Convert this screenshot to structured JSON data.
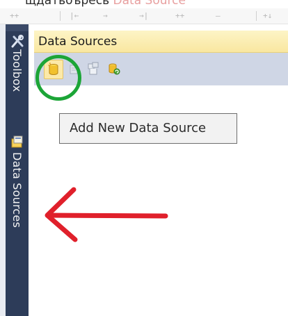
{
  "top_caption": {
    "text_plain": "щдатьоъресь",
    "text_highlight": "Data Source"
  },
  "ruler_marks": [
    "++",
    "|",
    "|←",
    "→",
    "→|",
    "++",
    "—",
    "+↓"
  ],
  "side_bar": {
    "toolbox_label": "Toolbox",
    "data_sources_label": "Data Sources"
  },
  "panel": {
    "title": "Data Sources"
  },
  "tooltip": {
    "text": "Add New Data Source"
  },
  "annotations": {
    "ring_color": "#1ca537",
    "arrow_color": "#e0202b"
  }
}
